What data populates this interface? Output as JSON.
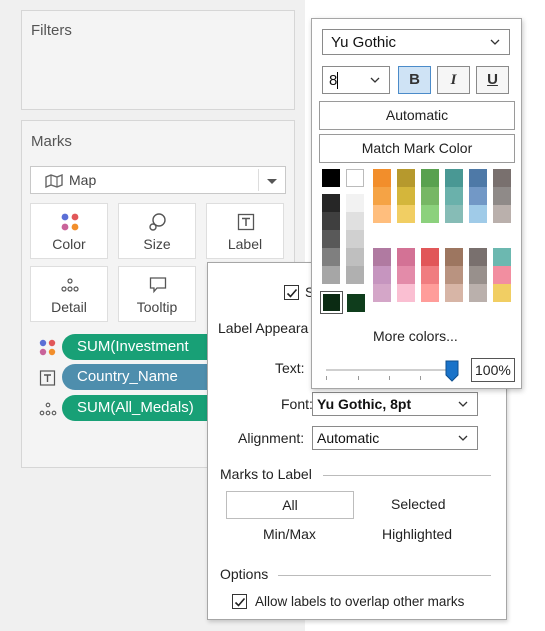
{
  "filters": {
    "title": "Filters"
  },
  "marks": {
    "title": "Marks",
    "type_label": "Map",
    "buttons": {
      "color": "Color",
      "size": "Size",
      "label": "Label",
      "detail": "Detail",
      "tooltip": "Tooltip"
    },
    "pills": [
      {
        "text": "SUM(Investment",
        "color": "#18a076"
      },
      {
        "text": "Country_Name",
        "color": "#4e8ead"
      },
      {
        "text": "SUM(All_Medals)",
        "color": "#18a076"
      }
    ]
  },
  "label_popup": {
    "show_label_partial": "S",
    "label_appearance": "Label Appeara",
    "text_label": "Text:",
    "font_label": "Font:",
    "font_value": "Yu Gothic, 8pt",
    "alignment_label": "Alignment:",
    "alignment_value": "Automatic",
    "marks_to_label": "Marks to Label",
    "opt_all": "All",
    "opt_selected": "Selected",
    "opt_minmax": "Min/Max",
    "opt_highlighted": "Highlighted",
    "options_label": "Options",
    "allow_overlap": "Allow labels to overlap other marks"
  },
  "font_popup": {
    "font_family": "Yu Gothic",
    "font_size": "8",
    "bold": "B",
    "italic": "I",
    "underline": "U",
    "automatic": "Automatic",
    "match_mark_color": "Match Mark Color",
    "more_colors": "More colors...",
    "opacity": "100%",
    "opacity_value": 1.0,
    "bold_active": true
  },
  "palette": {
    "gray_col1": [
      "#000000",
      "#262626",
      "#3f3f3f",
      "#595959",
      "#7f7f7f"
    ],
    "gray_col2": [
      "#ffffff",
      "#f2f2f2",
      "#d9d9d9",
      "#bfbfbf",
      "#a6a6a6"
    ],
    "block1": [
      [
        "#f28e2b",
        "#b6992d",
        "#59a14f",
        "#499894",
        "#4e79a7",
        "#79706e"
      ],
      [
        "#f5a345",
        "#d4b63b",
        "#77b765",
        "#6ab1ab",
        "#7298c6",
        "#8f8a88"
      ],
      [
        "#ffbe7d",
        "#f1ce63",
        "#8cd17d",
        "#86bcb6",
        "#a0cbe8",
        "#bab0ac"
      ]
    ],
    "block2": [
      [
        "#b07aa1",
        "#d37295",
        "#e15759",
        "#9d7660",
        "#79706e",
        "#6cb8b0"
      ],
      [
        "#c695bf",
        "#e38ba9",
        "#f07d80",
        "#b99380",
        "#98908c",
        "#f28ea0"
      ],
      [
        "#d4a6c8",
        "#fabfd2",
        "#ff9d9a",
        "#d7b5a6",
        "#bab0ac",
        "#f1ce63"
      ]
    ],
    "recent": [
      "#0b2b13",
      "#0f3d1c"
    ]
  }
}
